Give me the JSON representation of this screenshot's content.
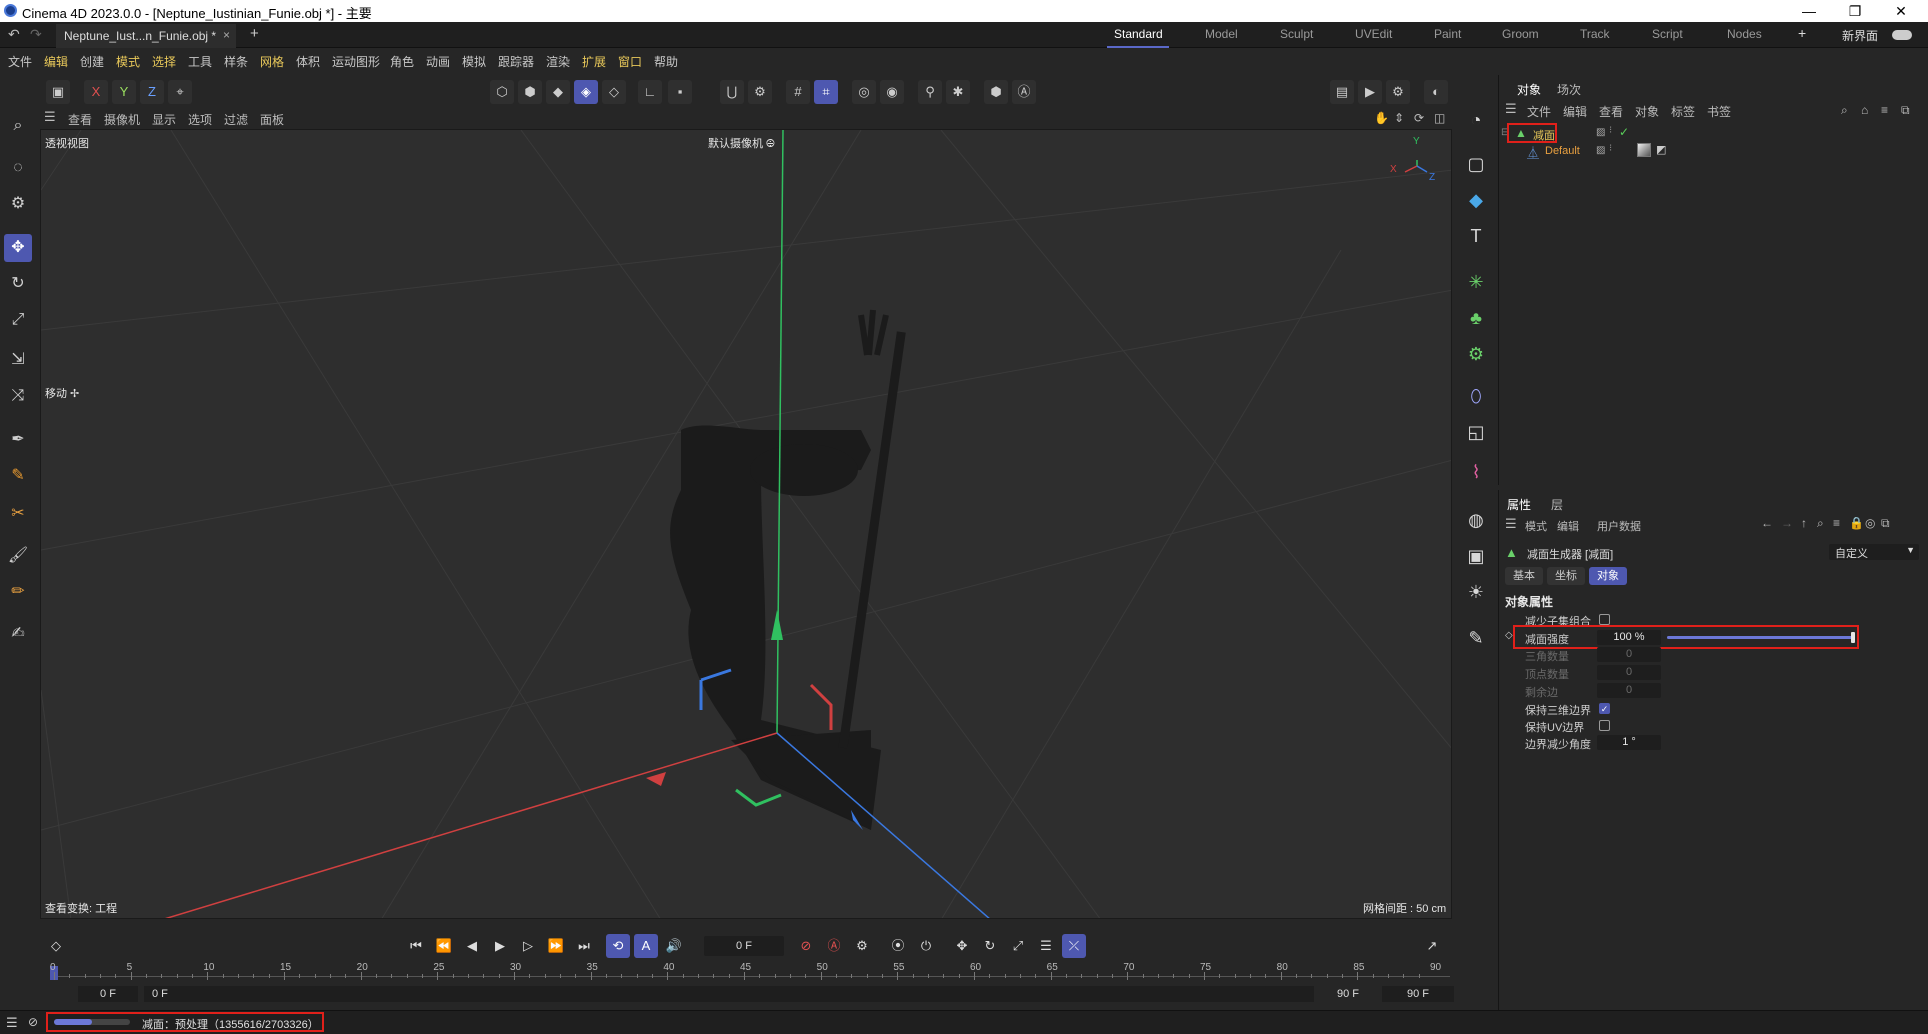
{
  "window": {
    "title": "Cinema 4D 2023.0.0 - [Neptune_Iustinian_Funie.obj *] - 主要",
    "minimize": "—",
    "maximize": "❐",
    "close": "✕"
  },
  "doc_tab": {
    "label": "Neptune_Iust...n_Funie.obj *",
    "close": "×",
    "add": "+"
  },
  "layouts": {
    "items": [
      "Standard",
      "Model",
      "Sculpt",
      "UVEdit",
      "Paint",
      "Groom",
      "Track",
      "Script",
      "Nodes"
    ],
    "active": "Standard",
    "add": "+",
    "new_ui": "新界面"
  },
  "menu": [
    "文件",
    "编辑",
    "创建",
    "模式",
    "选择",
    "工具",
    "样条",
    "网格",
    "体积",
    "运动图形",
    "角色",
    "动画",
    "模拟",
    "跟踪器",
    "渲染",
    "扩展",
    "窗口",
    "帮助"
  ],
  "toolbar": {
    "x": "X",
    "y": "Y",
    "z": "Z"
  },
  "viewport_menu": [
    "查看",
    "摄像机",
    "显示",
    "选项",
    "过滤",
    "面板"
  ],
  "viewport": {
    "name": "透视视图",
    "camera": "默认摄像机 ⨸",
    "tool_hint": "移动 ✢",
    "transform": "查看变换: 工程",
    "grid": "网格间距 : 50 cm",
    "axis_x": "X",
    "axis_y": "Y",
    "axis_z": "Z"
  },
  "object_panel": {
    "tabs": [
      "对象",
      "场次"
    ],
    "menu": [
      "文件",
      "编辑",
      "查看",
      "对象",
      "标签",
      "书签"
    ],
    "objects": [
      {
        "name": "减面",
        "color": "#e8c85a"
      },
      {
        "name": "Default",
        "color": "#e8a040"
      }
    ]
  },
  "attr_panel": {
    "tabs": [
      "属性",
      "层"
    ],
    "menu": [
      "模式",
      "编辑",
      "用户数据"
    ],
    "object_title": "减面生成器 [减面]",
    "preset": "自定义",
    "subtabs": [
      "基本",
      "坐标",
      "对象"
    ],
    "active_subtab": "对象",
    "section": "对象属性",
    "fields": {
      "reduce_children": "减少子集组合",
      "strength_label": "减面强度",
      "strength_value": "100 %",
      "strength_fraction": 1.0,
      "tri_label": "三角数量",
      "tri_value": "0",
      "vert_label": "顶点数量",
      "vert_value": "0",
      "edge_label": "剩余边",
      "edge_value": "0",
      "keep3d_label": "保持三维边界",
      "keepuv_label": "保持UV边界",
      "angle_label": "边界减少角度",
      "angle_value": "1 °"
    }
  },
  "timeline": {
    "current_frame": "0 F",
    "ticks": [
      "0",
      "5",
      "10",
      "15",
      "20",
      "25",
      "30",
      "35",
      "40",
      "45",
      "50",
      "55",
      "60",
      "65",
      "70",
      "75",
      "80",
      "85",
      "90"
    ],
    "start_a": "0 F",
    "start_b": "0 F",
    "end_a": "90 F",
    "end_b": "90 F"
  },
  "status": {
    "progress_fraction": 0.5,
    "text": "减面：预处理（1355616/2703326）"
  },
  "colors": {
    "accent": "#4e58b0",
    "highlight": "#e0201a",
    "yellow": "#e8c85a"
  }
}
